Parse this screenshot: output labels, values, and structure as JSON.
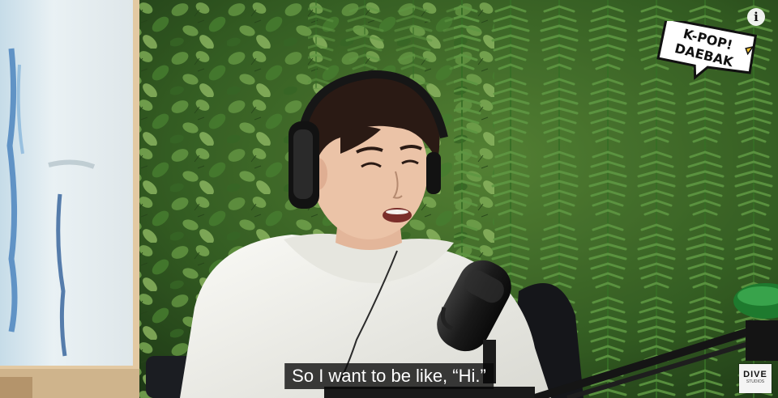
{
  "video": {
    "subtitle": "So I want to be like, “Hi.”"
  },
  "overlay": {
    "info_glyph": "i",
    "info_icon": "info-icon",
    "channel_logo": {
      "text_line1": "K-POP!",
      "text_line2": "DAEBAK",
      "icon": "kpop-daebak-logo"
    },
    "watermark": {
      "main": "DIVE",
      "sub": "STUDIOS"
    }
  },
  "colors": {
    "subtitle_bg": "#080808",
    "subtitle_text": "#ffffff",
    "leaf_dark": "#2f5a22",
    "leaf_light": "#6fa54a",
    "hoodie": "#f1f1ec",
    "hair": "#2a1a14"
  }
}
